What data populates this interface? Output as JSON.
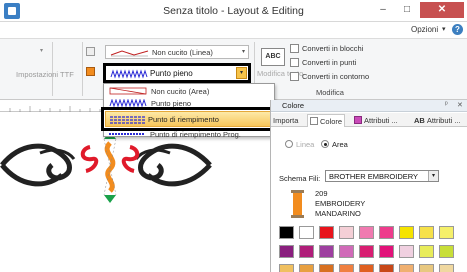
{
  "window": {
    "title": "Senza titolo - Layout & Editing",
    "min_glyph": "–",
    "max_glyph": "□",
    "close_glyph": "✕"
  },
  "menubar": {
    "opzioni": "Opzioni",
    "arrow": "▾",
    "help": "?"
  },
  "ribbon": {
    "impostazioni_ttf": "Impostazioni TTF",
    "line_combo_label": "Non cucito (Linea)",
    "fill_combo_label": "Punto pieno",
    "modifica_testo": "Modifica testo",
    "abc_label": "ABC",
    "converti_blocchi": "Converti in blocchi",
    "converti_punti": "Converti in punti",
    "converti_contorno": "Converti in contorno",
    "group_label": "Modifica",
    "combo_arrow": "▾"
  },
  "dropdown": {
    "items": [
      {
        "label": "Non cucito (Area)"
      },
      {
        "label": "Punto pieno"
      },
      {
        "label": "Punto di riempimento"
      },
      {
        "label": "Punto di riempimento Prog."
      }
    ]
  },
  "panel": {
    "title": "Colore",
    "pin_glyph": "ᵖ",
    "close_glyph": "✕",
    "tabs": [
      {
        "label": "Importa"
      },
      {
        "label": "Colore"
      },
      {
        "label": "Attributi ..."
      },
      {
        "label": "Attributi ..."
      }
    ],
    "ab_label": "AB",
    "radio_linea": "Linea",
    "radio_area": "Area",
    "schema_label": "Schema Fili:",
    "schema_value": "BROTHER EMBROIDERY",
    "thread_code": "209",
    "thread_brand": "EMBROIDERY",
    "thread_name": "MANDARINO",
    "thread_color": "#f28c1e",
    "swatches_row1": [
      "#000000",
      "#ffffff",
      "#e8141c",
      "#f4cfd6",
      "#f07ab0",
      "#ee3c8c",
      "#f5e300",
      "#f6e14a",
      "#f5f06a"
    ],
    "swatches_row2": [
      "#8a1f7e",
      "#b01e7a",
      "#9e3fa0",
      "#d06ab8",
      "#d81e72",
      "#e2127a",
      "#f0d0e0",
      "#e8ec5a",
      "#c8de38"
    ],
    "swatches_row3": [
      "#f0c060",
      "#e8a040",
      "#d87020",
      "#f08040",
      "#e06020",
      "#c84818",
      "#f0b070",
      "#e8c880",
      "#f0d8a0"
    ]
  },
  "colors": {
    "highlight_top": "#fde9a8",
    "highlight_bottom": "#f7c65b",
    "stitch_blue": "#2b2bd6"
  }
}
